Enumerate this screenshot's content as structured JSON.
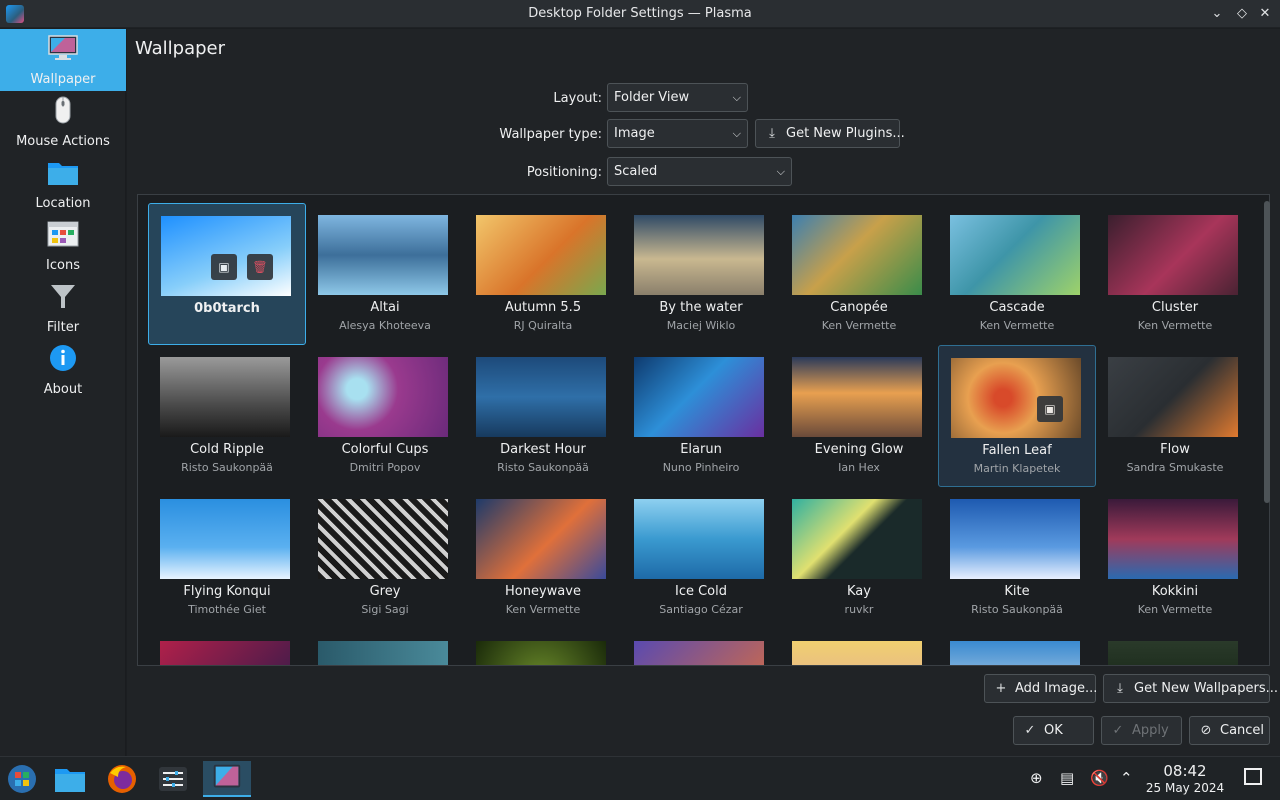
{
  "window": {
    "title": "Desktop Folder Settings — Plasma",
    "controls": [
      "chevron-down",
      "restore",
      "close"
    ]
  },
  "sidebar": {
    "items": [
      {
        "label": "Wallpaper",
        "icon": "monitor-icon",
        "active": true
      },
      {
        "label": "Mouse Actions",
        "icon": "mouse-icon"
      },
      {
        "label": "Location",
        "icon": "folder-icon"
      },
      {
        "label": "Icons",
        "icon": "icons-grid-icon"
      },
      {
        "label": "Filter",
        "icon": "filter-funnel-icon"
      },
      {
        "label": "About",
        "icon": "info-icon"
      }
    ]
  },
  "main": {
    "title": "Wallpaper",
    "layout": {
      "label": "Layout:",
      "value": "Folder View"
    },
    "wallpaper_type": {
      "label": "Wallpaper type:",
      "value": "Image"
    },
    "get_new_plugins": "Get New Plugins...",
    "positioning": {
      "label": "Positioning:",
      "value": "Scaled"
    },
    "add_image": "Add Image...",
    "get_new_wallpapers": "Get New Wallpapers...",
    "ok": "OK",
    "apply": "Apply",
    "cancel": "Cancel"
  },
  "wallpapers": [
    {
      "name": "0b0tarch",
      "author": ""
    },
    {
      "name": "Altai",
      "author": "Alesya Khoteeva"
    },
    {
      "name": "Autumn 5.5",
      "author": "RJ Quiralta"
    },
    {
      "name": "By the water",
      "author": "Maciej Wiklo"
    },
    {
      "name": "Canopée",
      "author": "Ken Vermette"
    },
    {
      "name": "Cascade",
      "author": "Ken Vermette"
    },
    {
      "name": "Cluster",
      "author": "Ken Vermette"
    },
    {
      "name": "Cold Ripple",
      "author": "Risto Saukonpää"
    },
    {
      "name": "Colorful Cups",
      "author": "Dmitri Popov"
    },
    {
      "name": "Darkest Hour",
      "author": "Risto Saukonpää"
    },
    {
      "name": "Elarun",
      "author": "Nuno Pinheiro"
    },
    {
      "name": "Evening Glow",
      "author": "Ian Hex"
    },
    {
      "name": "Fallen Leaf",
      "author": "Martin Klapetek"
    },
    {
      "name": "Flow",
      "author": "Sandra Smukaste"
    },
    {
      "name": "Flying Konqui",
      "author": "Timothée Giet"
    },
    {
      "name": "Grey",
      "author": "Sigi Sagi"
    },
    {
      "name": "Honeywave",
      "author": "Ken Vermette"
    },
    {
      "name": "Ice Cold",
      "author": "Santiago Cézar"
    },
    {
      "name": "Kay",
      "author": "ruvkr"
    },
    {
      "name": "Kite",
      "author": "Risto Saukonpää"
    },
    {
      "name": "Kokkini",
      "author": "Ken Vermette"
    }
  ],
  "thumb_colors": [
    "linear-gradient(160deg,#1e90ff,#87cefa 60%,#ffffff)",
    "linear-gradient(180deg,#7fb6e0,#3d6f9a 50%,#8ec8e8)",
    "linear-gradient(135deg,#f2c66b,#d9742a 55%,#7aa84e)",
    "linear-gradient(180deg,#2f4a66,#c9b890 55%,#8a7f6b)",
    "linear-gradient(135deg,#3c7fb0,#c8a04a 45%,#3a8c4a)",
    "linear-gradient(135deg,#7ac0e0,#3e95a8 45%,#9ed26a)",
    "linear-gradient(135deg,#3a1f2e,#a8355a 55%,#4a2333)",
    "linear-gradient(180deg,#9a9a9a,#4a4a4a 60%,#1a1a1a)",
    "radial-gradient(circle at 30% 40%,#a8e0f0 10%,#9a3a8e 40%,#6a2a7a)",
    "linear-gradient(180deg,#1d4a7a,#2f6fa8 50%,#173a5e)",
    "linear-gradient(135deg,#0e3a6e,#2d8fd8 45%,#6a2fa0)",
    "linear-gradient(180deg,#2a3a5a,#e8a050 45%,#6a4a3a)",
    "radial-gradient(circle at 40% 50%,#d84a2a 10%,#e8a050 40%,#6a4a2a)",
    "linear-gradient(135deg,#3a3f44,#2a2e32 50%,#e07a30)",
    "linear-gradient(180deg,#2a8fe0,#5ab0f0 60%,#e8f4ff)",
    "repeating-linear-gradient(45deg,#1a1a1a 0 6px,#d0d0d0 6px 10px)",
    "linear-gradient(135deg,#1e3a6a,#e0703a 55%,#3a4a9a)",
    "linear-gradient(180deg,#8ed0f0,#3a9ad0 50%,#1e6aa8)",
    "linear-gradient(135deg,#30b0a0,#e0e070 40%,#1a2a2a 55%)",
    "linear-gradient(180deg,#1e5ab0,#5a9ae0 60%,#e8f0ff)",
    "linear-gradient(180deg,#3a1a3a,#a03a5a 50%,#2a6ab0)",
    "linear-gradient(135deg,#b0204a,#2a1a4a)",
    "linear-gradient(90deg,#2a5a6a,#4a8a9a)",
    "radial-gradient(circle,#6a8a2a,#1a2a0a)",
    "linear-gradient(135deg,#5a4ab0,#e0703a)",
    "linear-gradient(180deg,#f0d070,#e0a0a0)",
    "linear-gradient(180deg,#3a8ad0,#f0f0f0)",
    "linear-gradient(180deg,#2a3a2a,#0a1a0a)"
  ],
  "taskbar": {
    "time": "08:42",
    "date": "25 May 2024",
    "apps": [
      "start-menu-icon",
      "file-manager-icon",
      "firefox-icon",
      "settings-mixer-icon",
      "plasma-settings-icon"
    ]
  }
}
